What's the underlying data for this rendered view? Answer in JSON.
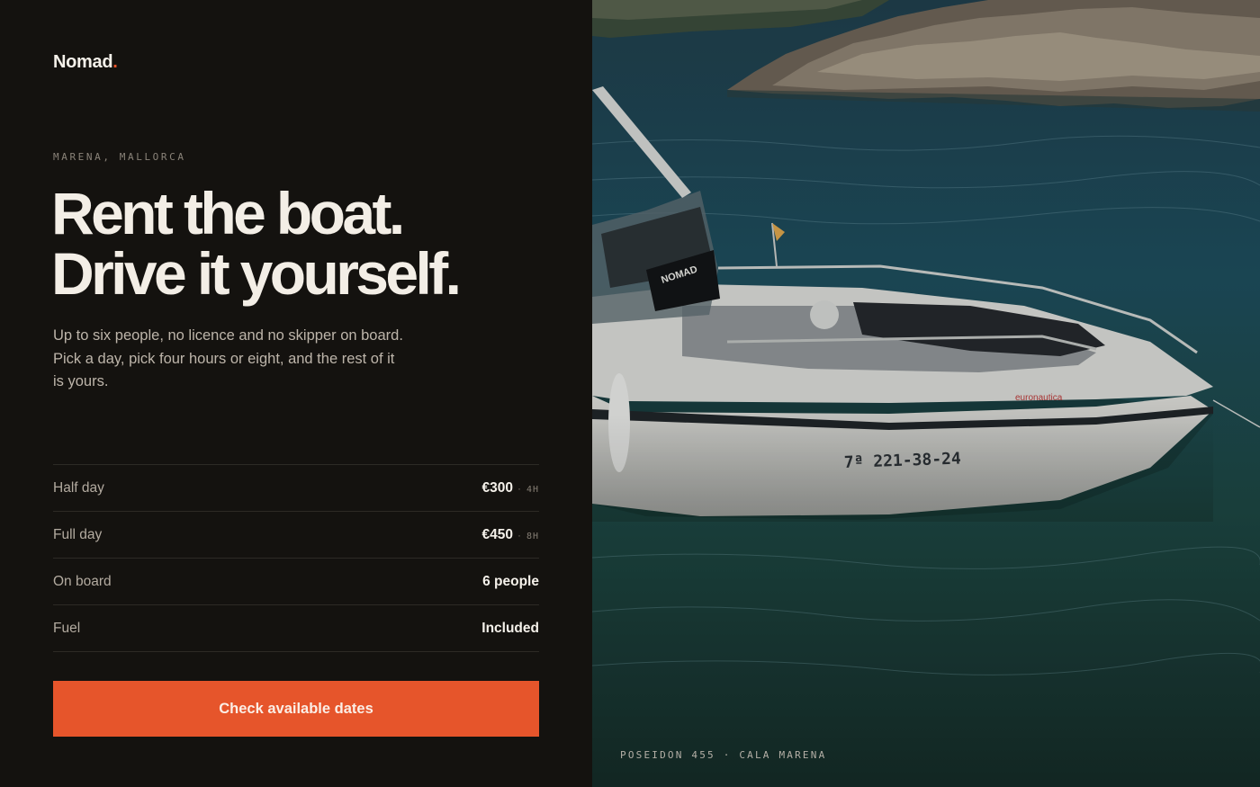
{
  "brand": {
    "name": "Nomad",
    "dot": "."
  },
  "hero": {
    "eyebrow": "MARENA, MALLORCA",
    "headline_line1": "Rent the boat.",
    "headline_line2": "Drive it yourself.",
    "lede": "Up to six people, no licence and no skipper on board. Pick a day, pick four hours or eight, and the rest of it is yours."
  },
  "specs": [
    {
      "label": "Half day",
      "value": "€300",
      "sep": "·",
      "unit": "4H"
    },
    {
      "label": "Full day",
      "value": "€450",
      "sep": "·",
      "unit": "8H"
    },
    {
      "label": "On board",
      "value": "6 people"
    },
    {
      "label": "Fuel",
      "value": "Included"
    }
  ],
  "cta": {
    "label": "Check available dates"
  },
  "photo": {
    "caption": "POSEIDON 455 · CALA MARENA",
    "hull_registration": "7ª 221-38-24",
    "console_text": "NOMAD",
    "hull_brand": "euronautica"
  },
  "colors": {
    "accent": "#e6552b",
    "background": "#14120f",
    "text": "#f3eee6"
  },
  "icons": []
}
